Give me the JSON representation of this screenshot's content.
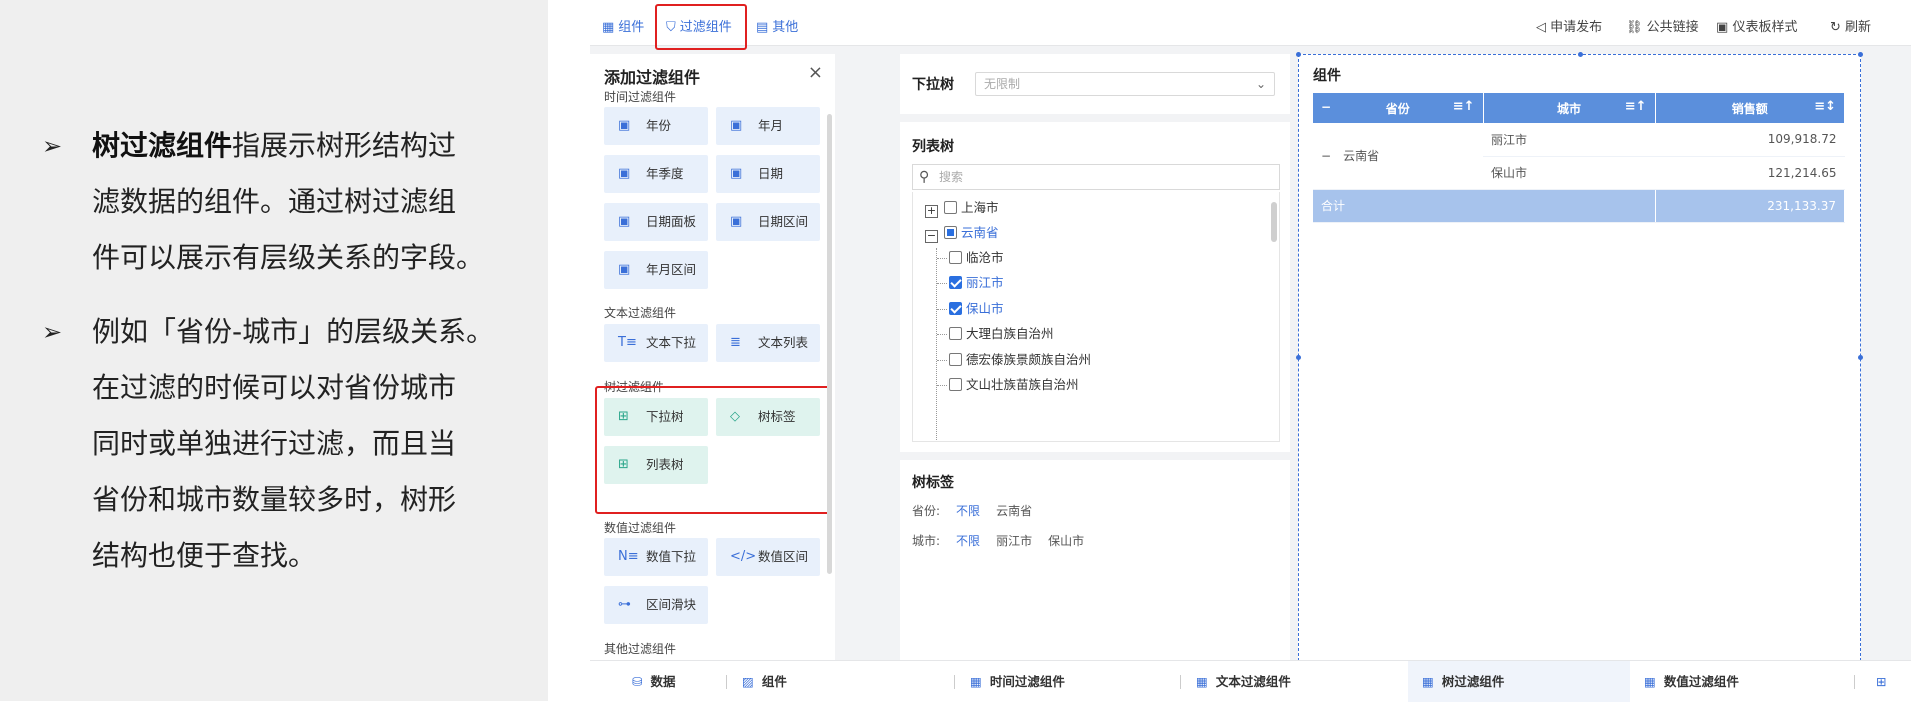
{
  "slide": {
    "bullets": [
      {
        "mark": "➢",
        "bold": "树过滤组件",
        "lines": [
          "指展示树形结构过",
          "滤数据的组件。通过树过滤组",
          "件可以展示有层级关系的字段。"
        ]
      },
      {
        "mark": "➢",
        "lines": [
          "例如「省份-城市」的层级关系。",
          "在过滤的时候可以对省份城市",
          "同时或单独进行过滤，而且当",
          "省份和城市数量较多时，树形",
          "结构也便于查找。"
        ]
      }
    ]
  },
  "topbar": {
    "tabs": [
      {
        "icon": "▦",
        "label": "组件"
      },
      {
        "icon": "⛉",
        "label": "过滤组件"
      },
      {
        "icon": "▤",
        "label": "其他"
      }
    ],
    "actions": [
      {
        "icon": "◁",
        "label": "申请发布"
      },
      {
        "icon": "⛓",
        "label": "公共链接"
      },
      {
        "icon": "▣",
        "label": "仪表板样式"
      },
      {
        "icon": "↻",
        "label": "刷新"
      }
    ]
  },
  "panel": {
    "title": "添加过滤组件",
    "close": "×",
    "sections": {
      "time": "时间过滤组件",
      "text": "文本过滤组件",
      "tree": "树过滤组件",
      "number": "数值过滤组件",
      "other": "其他过滤组件"
    },
    "time_items": [
      {
        "icon": "▣",
        "label": "年份"
      },
      {
        "icon": "▣",
        "label": "年月"
      },
      {
        "icon": "▣",
        "label": "年季度"
      },
      {
        "icon": "▣",
        "label": "日期"
      },
      {
        "icon": "▣",
        "label": "日期面板"
      },
      {
        "icon": "▣",
        "label": "日期区间"
      },
      {
        "icon": "▣",
        "label": "年月区间"
      }
    ],
    "text_items": [
      {
        "icon": "T≡",
        "label": "文本下拉"
      },
      {
        "icon": "≣",
        "label": "文本列表"
      }
    ],
    "tree_items": [
      {
        "icon": "⊞",
        "label": "下拉树"
      },
      {
        "icon": "◇",
        "label": "树标签"
      },
      {
        "icon": "⊞",
        "label": "列表树"
      }
    ],
    "number_items": [
      {
        "icon": "N≡",
        "label": "数值下拉"
      },
      {
        "icon": "</>",
        "label": "数值区间"
      },
      {
        "icon": "⊶",
        "label": "区间滑块"
      }
    ]
  },
  "dropdown_tree": {
    "title": "下拉树",
    "placeholder": "无限制",
    "chevron": "⌄"
  },
  "list_tree": {
    "title": "列表树",
    "search_placeholder": "搜索",
    "nodes": [
      "上海市",
      "云南省",
      "临沧市",
      "丽江市",
      "保山市",
      "大理白族自治州",
      "德宏傣族景颇族自治州",
      "文山壮族苗族自治州"
    ]
  },
  "tree_tags": {
    "title": "树标签",
    "province_label": "省份:",
    "province_all": "不限",
    "province_value": "云南省",
    "city_label": "城市:",
    "city_all": "不限",
    "city_values": [
      "丽江市",
      "保山市"
    ]
  },
  "table": {
    "title": "组件",
    "collapse": "−",
    "headers": [
      "省份",
      "城市",
      "销售额"
    ],
    "province": "云南省",
    "rows": [
      {
        "city": "丽江市",
        "sales": "109,918.72"
      },
      {
        "city": "保山市",
        "sales": "121,214.65"
      }
    ],
    "total_label": "合计",
    "total_value": "231,133.37"
  },
  "bottombar": {
    "tabs": [
      {
        "icon": "⛁",
        "label": "数据"
      },
      {
        "icon": "▨",
        "label": "组件"
      },
      {
        "icon": "▦",
        "label": "时间过滤组件"
      },
      {
        "icon": "▦",
        "label": "文本过滤组件"
      },
      {
        "icon": "▦",
        "label": "树过滤组件"
      },
      {
        "icon": "▦",
        "label": "数值过滤组件"
      }
    ]
  },
  "colors": {
    "accent": "#3a6fd8",
    "highlight_border": "#e02020",
    "tree_chip": "#dff3ee",
    "chip": "#e8f0fb",
    "table_header": "#5b8fdc",
    "table_total": "#a7c3ec"
  }
}
